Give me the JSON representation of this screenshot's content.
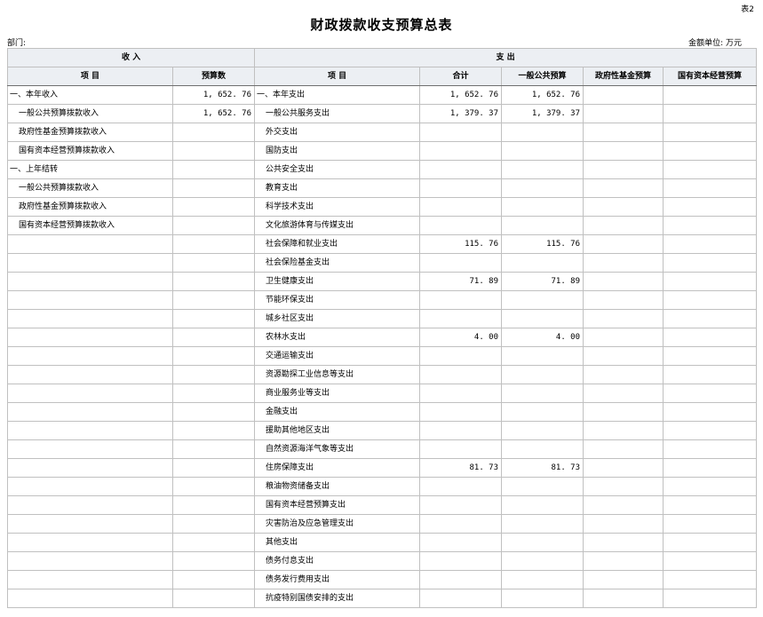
{
  "table_no": "表2",
  "title": "财政拨款收支预算总表",
  "dept_label": "部门:",
  "unit_label": "金额单位: 万元",
  "header": {
    "income": "收 入",
    "expense": "支 出",
    "col_item": "项 目",
    "col_budget": "预算数",
    "col_item2": "项 目",
    "col_total": "合计",
    "col_general": "一般公共预算",
    "col_fund": "政府性基金预算",
    "col_state": "国有资本经营预算"
  },
  "rows": [
    {
      "in_item": "一、本年收入",
      "in_level": 0,
      "in_amt": "1, 652. 76",
      "ex_item": "一、本年支出",
      "ex_level": 0,
      "total": "1, 652. 76",
      "general": "1, 652. 76",
      "fund": "",
      "state": ""
    },
    {
      "in_item": "一般公共预算拨款收入",
      "in_level": 1,
      "in_amt": "1, 652. 76",
      "ex_item": "一般公共服务支出",
      "ex_level": 1,
      "total": "1, 379. 37",
      "general": "1, 379. 37",
      "fund": "",
      "state": ""
    },
    {
      "in_item": "政府性基金预算拨款收入",
      "in_level": 1,
      "in_amt": "",
      "ex_item": "外交支出",
      "ex_level": 1,
      "total": "",
      "general": "",
      "fund": "",
      "state": ""
    },
    {
      "in_item": "国有资本经营预算拨款收入",
      "in_level": 1,
      "in_amt": "",
      "ex_item": "国防支出",
      "ex_level": 1,
      "total": "",
      "general": "",
      "fund": "",
      "state": ""
    },
    {
      "in_item": "一、上年结转",
      "in_level": 0,
      "in_amt": "",
      "ex_item": "公共安全支出",
      "ex_level": 1,
      "total": "",
      "general": "",
      "fund": "",
      "state": ""
    },
    {
      "in_item": "一般公共预算拨款收入",
      "in_level": 1,
      "in_amt": "",
      "ex_item": "教育支出",
      "ex_level": 1,
      "total": "",
      "general": "",
      "fund": "",
      "state": ""
    },
    {
      "in_item": "政府性基金预算拨款收入",
      "in_level": 1,
      "in_amt": "",
      "ex_item": "科学技术支出",
      "ex_level": 1,
      "total": "",
      "general": "",
      "fund": "",
      "state": ""
    },
    {
      "in_item": "国有资本经营预算拨款收入",
      "in_level": 1,
      "in_amt": "",
      "ex_item": "文化旅游体育与传媒支出",
      "ex_level": 1,
      "total": "",
      "general": "",
      "fund": "",
      "state": ""
    },
    {
      "in_item": "",
      "in_level": 1,
      "in_amt": "",
      "ex_item": "社会保障和就业支出",
      "ex_level": 1,
      "total": "115. 76",
      "general": "115. 76",
      "fund": "",
      "state": ""
    },
    {
      "in_item": "",
      "in_level": 1,
      "in_amt": "",
      "ex_item": "社会保险基金支出",
      "ex_level": 1,
      "total": "",
      "general": "",
      "fund": "",
      "state": ""
    },
    {
      "in_item": "",
      "in_level": 1,
      "in_amt": "",
      "ex_item": "卫生健康支出",
      "ex_level": 1,
      "total": "71. 89",
      "general": "71. 89",
      "fund": "",
      "state": ""
    },
    {
      "in_item": "",
      "in_level": 1,
      "in_amt": "",
      "ex_item": "节能环保支出",
      "ex_level": 1,
      "total": "",
      "general": "",
      "fund": "",
      "state": ""
    },
    {
      "in_item": "",
      "in_level": 1,
      "in_amt": "",
      "ex_item": "城乡社区支出",
      "ex_level": 1,
      "total": "",
      "general": "",
      "fund": "",
      "state": ""
    },
    {
      "in_item": "",
      "in_level": 1,
      "in_amt": "",
      "ex_item": "农林水支出",
      "ex_level": 1,
      "total": "4. 00",
      "general": "4. 00",
      "fund": "",
      "state": ""
    },
    {
      "in_item": "",
      "in_level": 1,
      "in_amt": "",
      "ex_item": "交通运输支出",
      "ex_level": 1,
      "total": "",
      "general": "",
      "fund": "",
      "state": ""
    },
    {
      "in_item": "",
      "in_level": 1,
      "in_amt": "",
      "ex_item": "资源勘探工业信息等支出",
      "ex_level": 1,
      "total": "",
      "general": "",
      "fund": "",
      "state": ""
    },
    {
      "in_item": "",
      "in_level": 1,
      "in_amt": "",
      "ex_item": "商业服务业等支出",
      "ex_level": 1,
      "total": "",
      "general": "",
      "fund": "",
      "state": ""
    },
    {
      "in_item": "",
      "in_level": 1,
      "in_amt": "",
      "ex_item": "金融支出",
      "ex_level": 1,
      "total": "",
      "general": "",
      "fund": "",
      "state": ""
    },
    {
      "in_item": "",
      "in_level": 1,
      "in_amt": "",
      "ex_item": "援助其他地区支出",
      "ex_level": 1,
      "total": "",
      "general": "",
      "fund": "",
      "state": ""
    },
    {
      "in_item": "",
      "in_level": 1,
      "in_amt": "",
      "ex_item": "自然资源海洋气象等支出",
      "ex_level": 1,
      "total": "",
      "general": "",
      "fund": "",
      "state": ""
    },
    {
      "in_item": "",
      "in_level": 1,
      "in_amt": "",
      "ex_item": "住房保障支出",
      "ex_level": 1,
      "total": "81. 73",
      "general": "81. 73",
      "fund": "",
      "state": ""
    },
    {
      "in_item": "",
      "in_level": 1,
      "in_amt": "",
      "ex_item": "粮油物资储备支出",
      "ex_level": 1,
      "total": "",
      "general": "",
      "fund": "",
      "state": ""
    },
    {
      "in_item": "",
      "in_level": 1,
      "in_amt": "",
      "ex_item": "国有资本经营预算支出",
      "ex_level": 1,
      "total": "",
      "general": "",
      "fund": "",
      "state": ""
    },
    {
      "in_item": "",
      "in_level": 1,
      "in_amt": "",
      "ex_item": "灾害防治及应急管理支出",
      "ex_level": 1,
      "total": "",
      "general": "",
      "fund": "",
      "state": ""
    },
    {
      "in_item": "",
      "in_level": 1,
      "in_amt": "",
      "ex_item": "其他支出",
      "ex_level": 1,
      "total": "",
      "general": "",
      "fund": "",
      "state": ""
    },
    {
      "in_item": "",
      "in_level": 1,
      "in_amt": "",
      "ex_item": "债务付息支出",
      "ex_level": 1,
      "total": "",
      "general": "",
      "fund": "",
      "state": ""
    },
    {
      "in_item": "",
      "in_level": 1,
      "in_amt": "",
      "ex_item": "债务发行费用支出",
      "ex_level": 1,
      "total": "",
      "general": "",
      "fund": "",
      "state": ""
    },
    {
      "in_item": "",
      "in_level": 1,
      "in_amt": "",
      "ex_item": "抗疫特别国债安排的支出",
      "ex_level": 1,
      "total": "",
      "general": "",
      "fund": "",
      "state": ""
    }
  ]
}
